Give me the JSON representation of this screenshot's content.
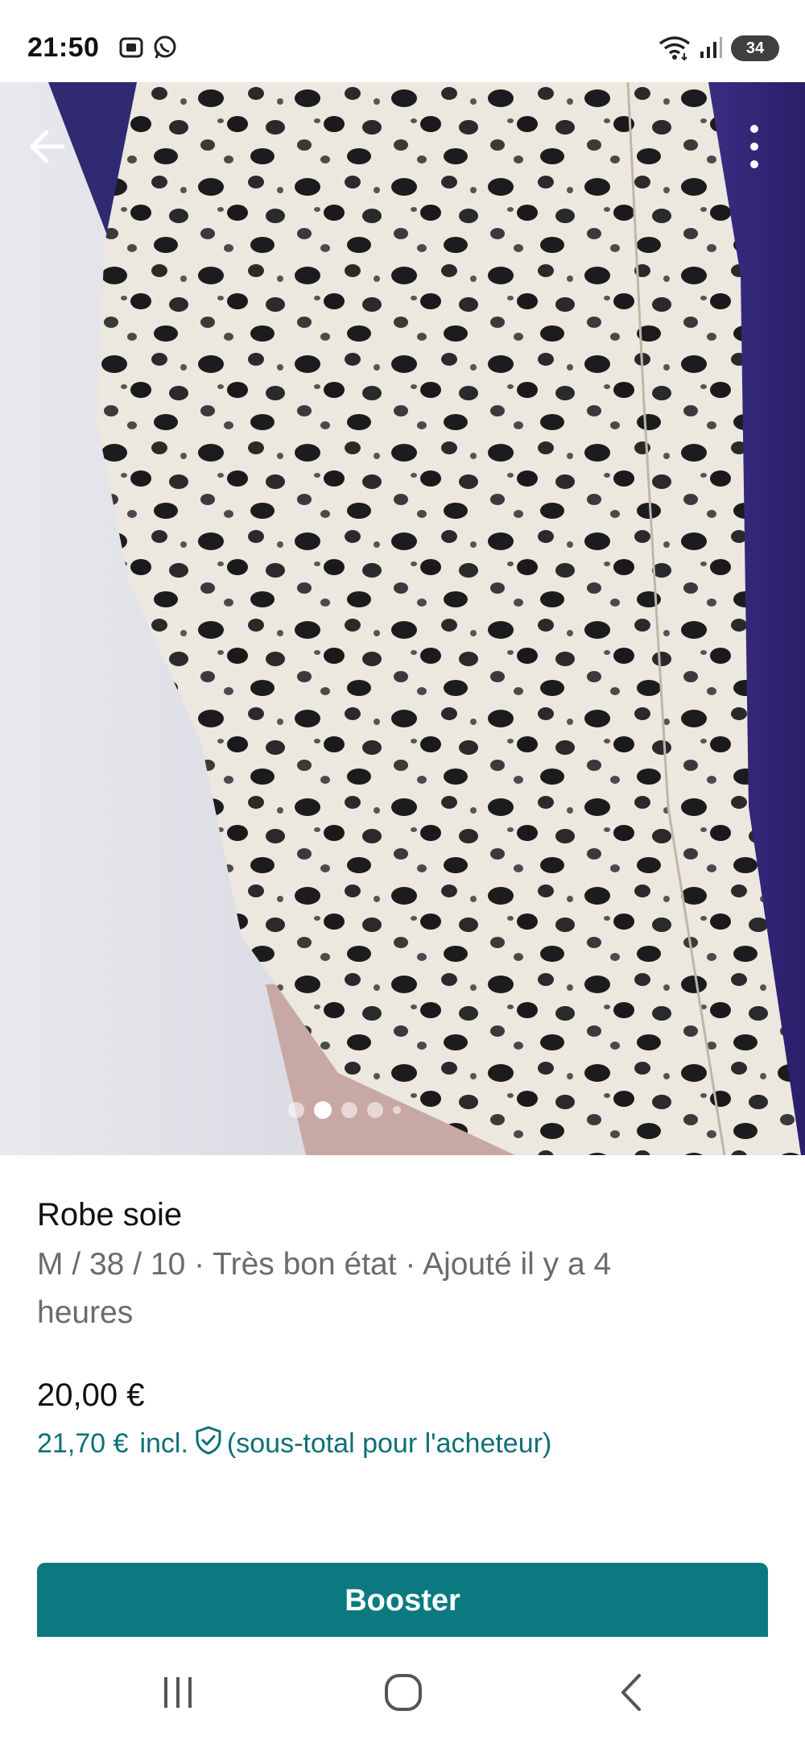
{
  "status_bar": {
    "time": "21:50",
    "battery": "34",
    "icons": [
      "screenshot-icon",
      "whatsapp-icon",
      "wifi-icon",
      "signal-icon"
    ]
  },
  "photo": {
    "carousel_count": 5,
    "active_index": 1
  },
  "listing": {
    "title": "Robe soie",
    "meta_line1": "M / 38 / 10 · Très bon état · Ajouté il y a 4",
    "meta_line2": "heures",
    "price": "20,00 €",
    "buyer_price": "21,70 €",
    "buyer_incl": "incl.",
    "buyer_note": "(sous-total pour l'acheteur)"
  },
  "actions": {
    "booster_label": "Booster"
  },
  "colors": {
    "accent": "#0b7a80",
    "buyer_text": "#0e6f77",
    "meta_text": "#6b6b6b"
  }
}
